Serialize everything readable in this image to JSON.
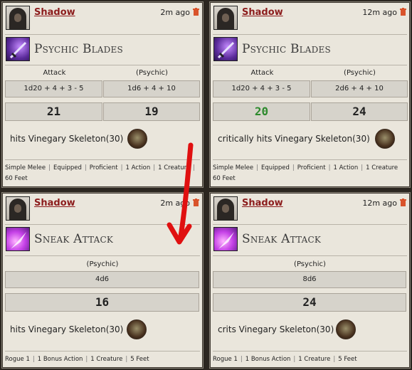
{
  "cards": [
    {
      "player": "Shadow",
      "time": "2m ago",
      "ability": "Psychic Blades",
      "attack_label": "Attack",
      "damage_label": "(Psychic)",
      "attack_formula": "1d20 + 4 + 3 - 5",
      "damage_formula": "1d6 + 4 + 10",
      "attack_total": "21",
      "damage_total": "19",
      "result": "hits Vinegary Skeleton(30)",
      "tags": [
        "Simple Melee",
        "Equipped",
        "Proficient",
        "1 Action",
        "1 Creature"
      ],
      "range": "60 Feet"
    },
    {
      "player": "Shadow",
      "time": "12m ago",
      "ability": "Psychic Blades",
      "attack_label": "Attack",
      "damage_label": "(Psychic)",
      "attack_formula": "1d20 + 4 + 3 - 5",
      "damage_formula": "2d6 + 4 + 10",
      "attack_total": "20",
      "damage_total": "24",
      "result": "critically hits Vinegary Skeleton(30)",
      "tags": [
        "Simple Melee",
        "Equipped",
        "Proficient",
        "1 Action",
        "1 Creature"
      ],
      "range": "60 Feet"
    },
    {
      "player": "Shadow",
      "time": "2m ago",
      "ability": "Sneak Attack",
      "damage_label": "(Psychic)",
      "damage_formula": "4d6",
      "damage_total": "16",
      "result": "hits Vinegary Skeleton(30)",
      "tags": [
        "Rogue 1",
        "1 Bonus Action",
        "1 Creature",
        "5 Feet"
      ]
    },
    {
      "player": "Shadow",
      "time": "12m ago",
      "ability": "Sneak Attack",
      "damage_label": "(Psychic)",
      "damage_formula": "8d6",
      "damage_total": "24",
      "result": "crits Vinegary Skeleton(30)",
      "tags": [
        "Rogue 1",
        "1 Bonus Action",
        "1 Creature",
        "5 Feet"
      ]
    }
  ],
  "icons": {
    "trash": "trash-icon",
    "psychic_blades": "psychic-blades-icon",
    "sneak_attack": "sneak-attack-icon",
    "target": "skeleton-avatar"
  },
  "colors": {
    "player_name": "#8c1c1c",
    "crit_attack_total": "#2d8a2d",
    "trash": "#d9532b",
    "annotation_arrow": "#e01010"
  }
}
